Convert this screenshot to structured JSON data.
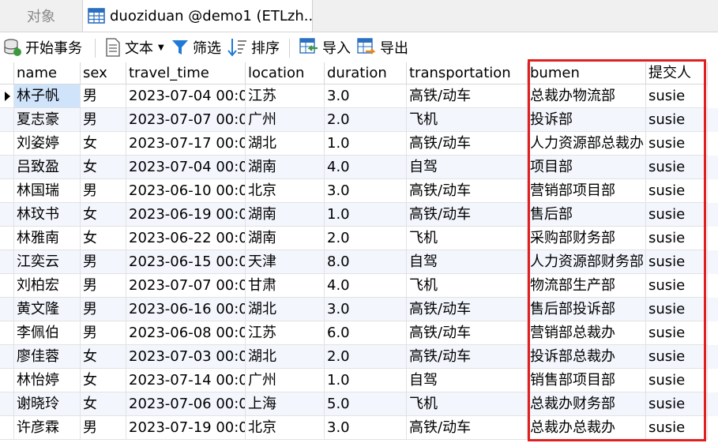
{
  "tabs": {
    "objects_label": "对象",
    "active_label": "duoziduan @demo1 (ETLzh..."
  },
  "toolbar": {
    "begin_transaction": "开始事务",
    "text": "文本",
    "filter": "筛选",
    "sort": "排序",
    "import": "导入",
    "export": "导出"
  },
  "table": {
    "columns": [
      "name",
      "sex",
      "travel_time",
      "location",
      "duration",
      "transportation",
      "bumen",
      "提交人"
    ],
    "rows": [
      [
        "林子帆",
        "男",
        "2023-07-04 00:0",
        "江苏",
        "3.0",
        "高铁/动车",
        "总裁办物流部",
        "susie"
      ],
      [
        "夏志豪",
        "男",
        "2023-07-07 00:0",
        "广州",
        "2.0",
        "飞机",
        "投诉部",
        "susie"
      ],
      [
        "刘姿婷",
        "女",
        "2023-07-17 00:0",
        "湖北",
        "1.0",
        "高铁/动车",
        "人力资源部总裁办",
        "susie"
      ],
      [
        "吕致盈",
        "女",
        "2023-07-04 00:0",
        "湖南",
        "4.0",
        "自驾",
        "项目部",
        "susie"
      ],
      [
        "林国瑞",
        "男",
        "2023-06-10 00:0",
        "北京",
        "3.0",
        "高铁/动车",
        "营销部项目部",
        "susie"
      ],
      [
        "林玟书",
        "女",
        "2023-06-19 00:0",
        "湖南",
        "1.0",
        "高铁/动车",
        "售后部",
        "susie"
      ],
      [
        "林雅南",
        "女",
        "2023-06-22 00:0",
        "湖南",
        "2.0",
        "飞机",
        "采购部财务部",
        "susie"
      ],
      [
        "江奕云",
        "男",
        "2023-06-15 00:0",
        "天津",
        "8.0",
        "自驾",
        "人力资源部财务部",
        "susie"
      ],
      [
        "刘柏宏",
        "男",
        "2023-07-07 00:0",
        "甘肃",
        "4.0",
        "飞机",
        "物流部生产部",
        "susie"
      ],
      [
        "黄文隆",
        "男",
        "2023-06-16 00:0",
        "湖北",
        "3.0",
        "高铁/动车",
        "售后部投诉部",
        "susie"
      ],
      [
        "李佩伯",
        "男",
        "2023-06-08 00:0",
        "江苏",
        "6.0",
        "高铁/动车",
        "营销部总裁办",
        "susie"
      ],
      [
        "廖佳蓉",
        "女",
        "2023-07-03 00:0",
        "湖北",
        "2.0",
        "高铁/动车",
        "投诉部总裁办",
        "susie"
      ],
      [
        "林怡婷",
        "女",
        "2023-07-14 00:0",
        "广州",
        "1.0",
        "自驾",
        "销售部项目部",
        "susie"
      ],
      [
        "谢晓玲",
        "女",
        "2023-07-06 00:0",
        "上海",
        "5.0",
        "飞机",
        "总裁办财务部",
        "susie"
      ],
      [
        "许彦霖",
        "男",
        "2023-07-19 00:0",
        "北京",
        "3.0",
        "高铁/动车",
        "总裁办总裁办",
        "susie"
      ]
    ]
  },
  "icons": {
    "table_tab": "table-icon",
    "begin_transaction": "database-transaction-icon",
    "text": "document-text-icon",
    "filter": "funnel-filter-icon",
    "sort": "sort-icon",
    "import": "import-icon",
    "export": "export-icon"
  },
  "colors": {
    "highlight_border": "#e02020",
    "selected_row": "#cfe3fb",
    "filter_icon": "#1e7ad6"
  }
}
